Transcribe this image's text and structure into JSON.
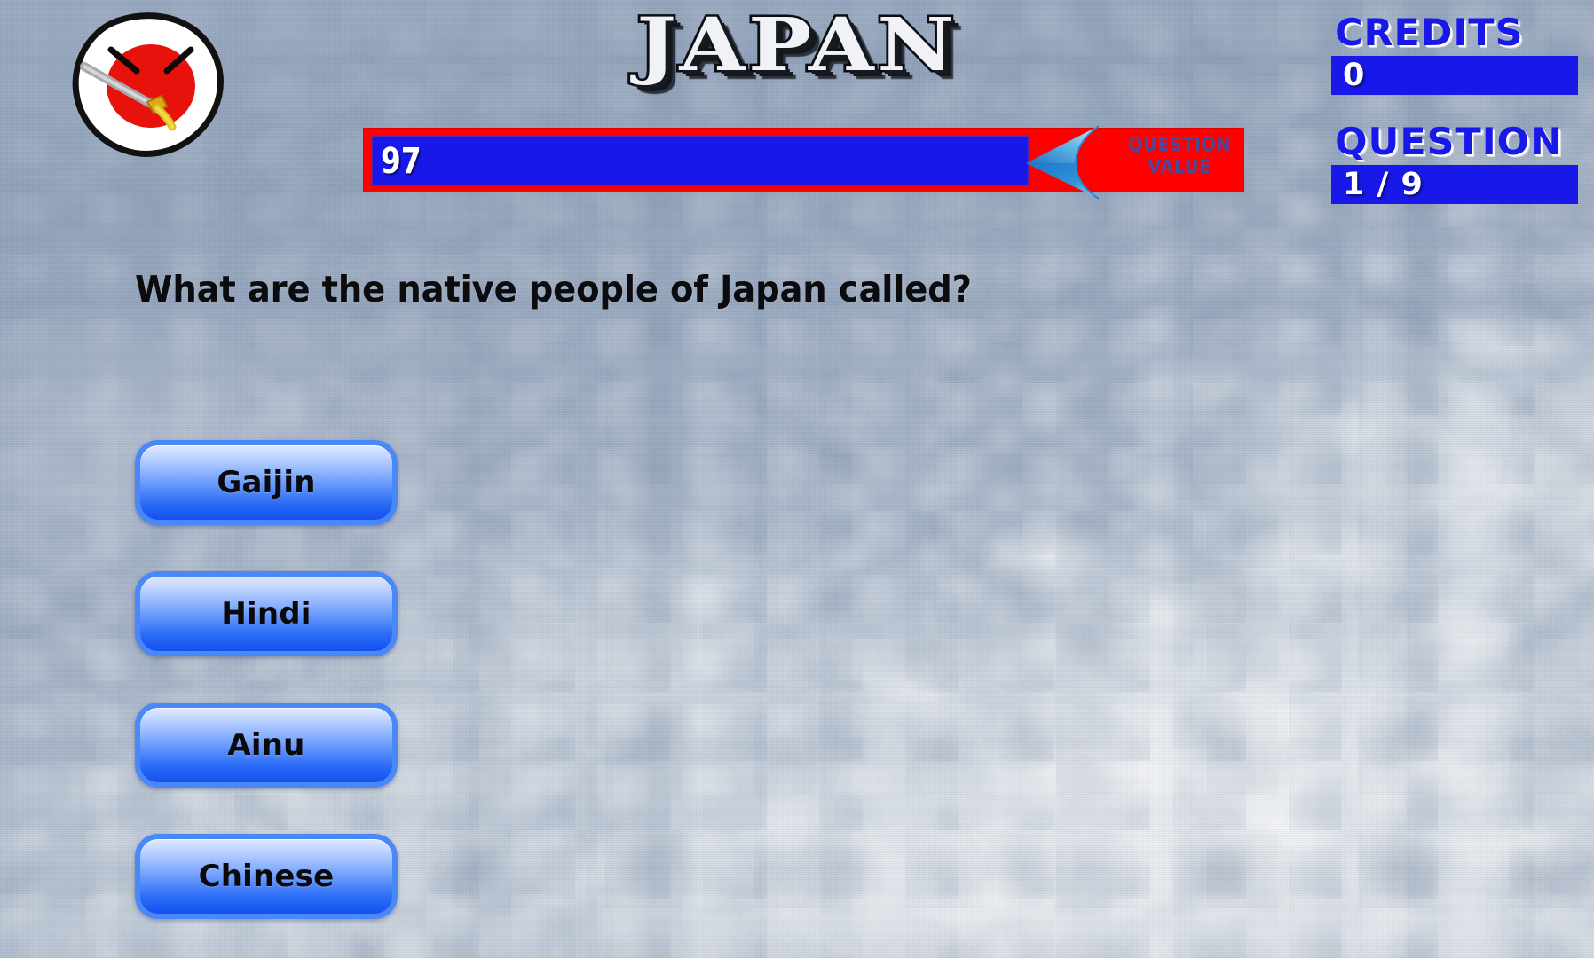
{
  "header": {
    "title": "JAPAN",
    "mascot_icon": "japan-countryball-icon"
  },
  "value_bar": {
    "value": "97",
    "caption_line1": "QUESTION",
    "caption_line2": "VALUE",
    "arrow_icon": "left-arrow-icon",
    "bar_color": "#ff0000",
    "fill_color": "#1818e8"
  },
  "hud": {
    "credits_label": "CREDITS",
    "credits_value": "0",
    "question_label": "QUESTION",
    "question_value": "1 / 9",
    "accent_color": "#1818e8"
  },
  "question": {
    "prompt": "What are the native people of Japan called?"
  },
  "answers": [
    {
      "label": "Gaijin"
    },
    {
      "label": "Hindi"
    },
    {
      "label": "Ainu"
    },
    {
      "label": "Chinese"
    }
  ]
}
